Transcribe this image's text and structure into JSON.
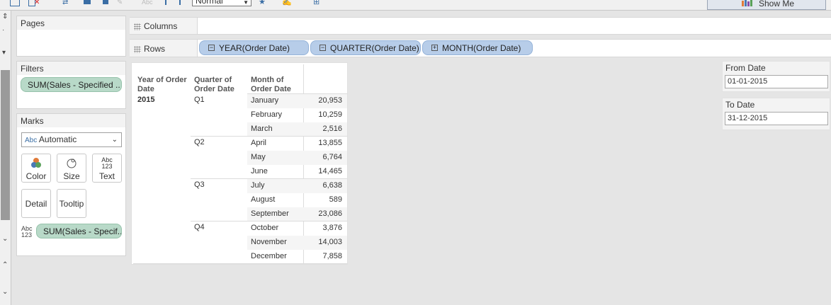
{
  "toolbar": {
    "style_select": "Normal",
    "show_me_label": "Show Me",
    "font_hint": "Abc"
  },
  "pages": {
    "title": "Pages"
  },
  "filters": {
    "title": "Filters",
    "pill": "SUM(Sales - Specified .."
  },
  "marks": {
    "title": "Marks",
    "type_select": "Automatic",
    "type_prefix": "Abc",
    "buttons": {
      "color": "Color",
      "size": "Size",
      "text": "Text",
      "detail": "Detail",
      "tooltip": "Tooltip"
    },
    "text_icon": "Abc\n123",
    "field_pill": "SUM(Sales - Specif.."
  },
  "shelves": {
    "columns_label": "Columns",
    "rows_label": "Rows",
    "row_pills": [
      {
        "label": "YEAR(Order Date)",
        "toggle": "−"
      },
      {
        "label": "QUARTER(Order Date)",
        "toggle": "−"
      },
      {
        "label": "MONTH(Order Date)",
        "toggle": "+"
      }
    ]
  },
  "table": {
    "headers": {
      "year": "Year of Order Date",
      "quarter": "Quarter of Order Date",
      "month": "Month of Order Date"
    },
    "year": "2015",
    "quarters": [
      "Q1",
      "Q2",
      "Q3",
      "Q4"
    ],
    "rows": [
      {
        "month": "January",
        "value": "20,953"
      },
      {
        "month": "February",
        "value": "10,259"
      },
      {
        "month": "March",
        "value": "2,516"
      },
      {
        "month": "April",
        "value": "13,855"
      },
      {
        "month": "May",
        "value": "6,764"
      },
      {
        "month": "June",
        "value": "14,465"
      },
      {
        "month": "July",
        "value": "6,638"
      },
      {
        "month": "August",
        "value": "589"
      },
      {
        "month": "September",
        "value": "23,086"
      },
      {
        "month": "October",
        "value": "3,876"
      },
      {
        "month": "November",
        "value": "14,003"
      },
      {
        "month": "December",
        "value": "7,858"
      }
    ]
  },
  "parameters": {
    "from": {
      "title": "From Date",
      "value": "01-01-2015"
    },
    "to": {
      "title": "To Date",
      "value": "31-12-2015"
    }
  },
  "colors": {
    "green_pill": "#b8d9c8",
    "blue_pill": "#b7cde9",
    "background": "#e5e5e5"
  }
}
